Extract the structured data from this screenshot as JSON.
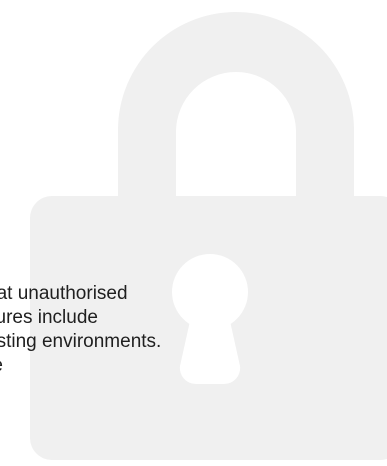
{
  "colors": {
    "background": "#ffffff",
    "lock_fill": "#f0f0f0",
    "keyhole": "#ffffff",
    "text": "#1f1f1f"
  },
  "icon": "padlock-icon",
  "text_lines": [
    "hat unauthorised",
    "sures include",
    "esting environments.",
    "re"
  ]
}
